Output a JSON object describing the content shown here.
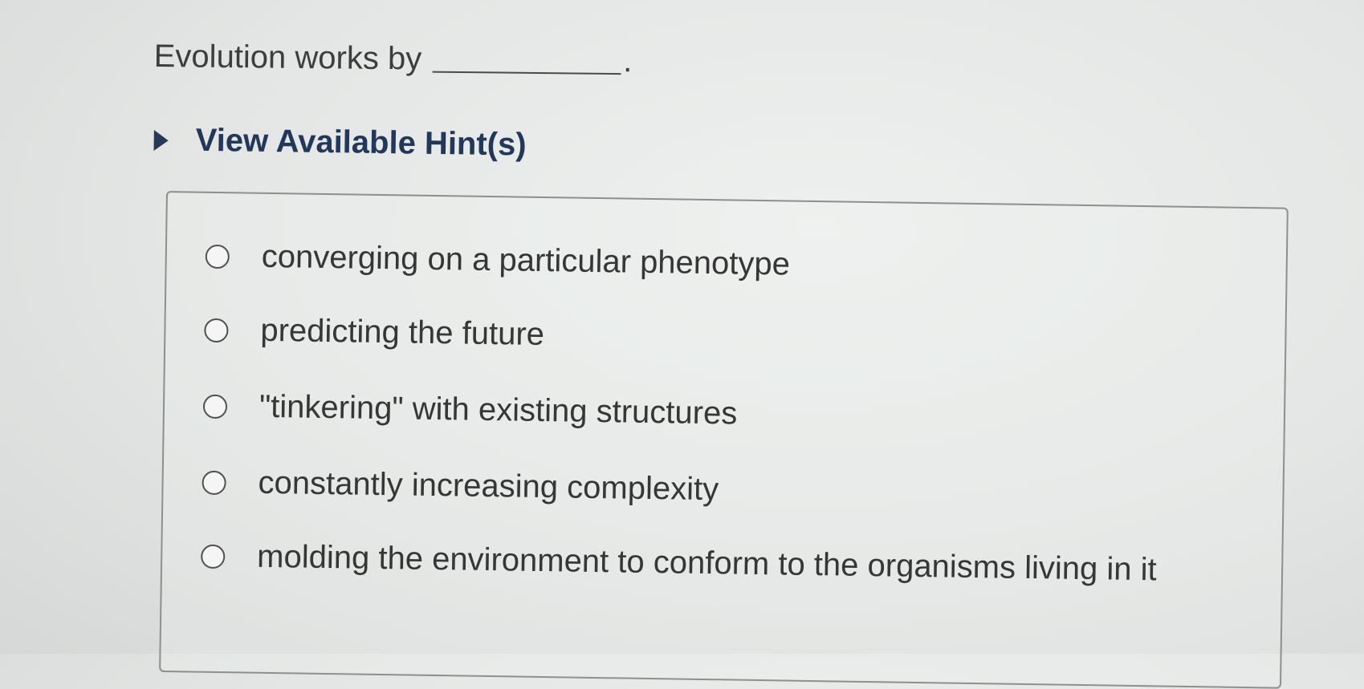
{
  "question": {
    "text": "Evolution works by",
    "period": "."
  },
  "hints": {
    "label": "View Available Hint(s)",
    "icon": "caret-right-icon"
  },
  "options": [
    {
      "label": "converging on a particular phenotype",
      "selected": false
    },
    {
      "label": "predicting the future",
      "selected": false
    },
    {
      "label": "\"tinkering\" with existing structures",
      "selected": false
    },
    {
      "label": "constantly increasing complexity",
      "selected": false
    },
    {
      "label": "molding the environment to conform to the organisms living in it",
      "selected": false
    }
  ],
  "colors": {
    "hint_text": "#22385a",
    "text": "#363636",
    "background": "#e4e6e5"
  }
}
